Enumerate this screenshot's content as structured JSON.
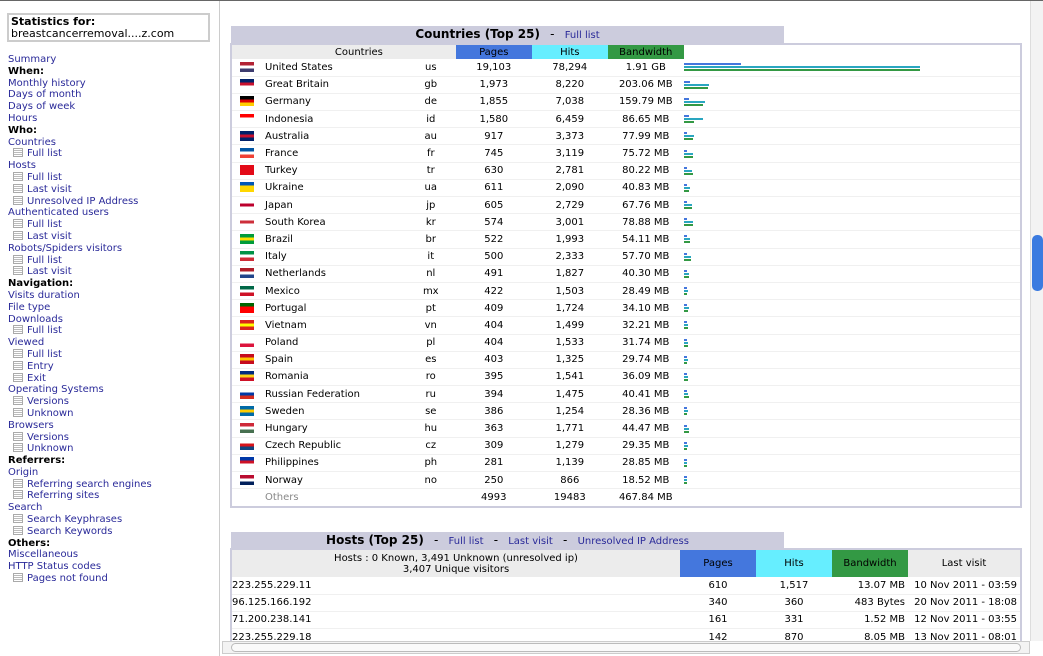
{
  "sidebar": {
    "stats_label": "Statistics for:",
    "site": "breastcancerremoval....z.com",
    "items": [
      {
        "t": "l",
        "label": "Summary"
      },
      {
        "t": "h",
        "label": "When:"
      },
      {
        "t": "l",
        "label": "Monthly history"
      },
      {
        "t": "l",
        "label": "Days of month"
      },
      {
        "t": "l",
        "label": "Days of week"
      },
      {
        "t": "l",
        "label": "Hours"
      },
      {
        "t": "h",
        "label": "Who:"
      },
      {
        "t": "l",
        "label": "Countries"
      },
      {
        "t": "s",
        "label": "Full list"
      },
      {
        "t": "l",
        "label": "Hosts"
      },
      {
        "t": "s",
        "label": "Full list"
      },
      {
        "t": "s",
        "label": "Last visit"
      },
      {
        "t": "s",
        "label": "Unresolved IP Address"
      },
      {
        "t": "l",
        "label": "Authenticated users"
      },
      {
        "t": "s",
        "label": "Full list"
      },
      {
        "t": "s",
        "label": "Last visit"
      },
      {
        "t": "l",
        "label": "Robots/Spiders visitors"
      },
      {
        "t": "s",
        "label": "Full list"
      },
      {
        "t": "s",
        "label": "Last visit"
      },
      {
        "t": "h",
        "label": "Navigation:"
      },
      {
        "t": "l",
        "label": "Visits duration"
      },
      {
        "t": "l",
        "label": "File type"
      },
      {
        "t": "l",
        "label": "Downloads"
      },
      {
        "t": "s",
        "label": "Full list"
      },
      {
        "t": "l",
        "label": "Viewed"
      },
      {
        "t": "s",
        "label": "Full list"
      },
      {
        "t": "s",
        "label": "Entry"
      },
      {
        "t": "s",
        "label": "Exit"
      },
      {
        "t": "l",
        "label": "Operating Systems"
      },
      {
        "t": "s",
        "label": "Versions"
      },
      {
        "t": "s",
        "label": "Unknown"
      },
      {
        "t": "l",
        "label": "Browsers"
      },
      {
        "t": "s",
        "label": "Versions"
      },
      {
        "t": "s",
        "label": "Unknown"
      },
      {
        "t": "h",
        "label": "Referrers:"
      },
      {
        "t": "l",
        "label": "Origin"
      },
      {
        "t": "s",
        "label": "Referring search engines"
      },
      {
        "t": "s",
        "label": "Referring sites"
      },
      {
        "t": "l",
        "label": "Search"
      },
      {
        "t": "s",
        "label": "Search Keyphrases"
      },
      {
        "t": "s",
        "label": "Search Keywords"
      },
      {
        "t": "h",
        "label": "Others:"
      },
      {
        "t": "l",
        "label": "Miscellaneous"
      },
      {
        "t": "l",
        "label": "HTTP Status codes"
      },
      {
        "t": "s",
        "label": "Pages not found"
      }
    ]
  },
  "colors": {
    "pages": "#4477dd",
    "hits": "#66eeff",
    "bandwidth": "#339944"
  },
  "countries": {
    "title": "Countries (Top 25)",
    "sep": "-",
    "full_list": "Full list",
    "headers": {
      "countries": "Countries",
      "pages": "Pages",
      "hits": "Hits",
      "bandwidth": "Bandwidth"
    },
    "rows": [
      {
        "name": "United States",
        "code": "us",
        "pages": "19,103",
        "hits": "78,294",
        "bw": "1.91 GB",
        "flag": [
          "#b22234",
          "#fff",
          "#3c3b6e"
        ]
      },
      {
        "name": "Great Britain",
        "code": "gb",
        "pages": "1,973",
        "hits": "8,220",
        "bw": "203.06 MB",
        "flag": [
          "#012169",
          "#c8102e",
          "#fff"
        ]
      },
      {
        "name": "Germany",
        "code": "de",
        "pages": "1,855",
        "hits": "7,038",
        "bw": "159.79 MB",
        "flag": [
          "#000",
          "#dd0000",
          "#ffce00"
        ]
      },
      {
        "name": "Indonesia",
        "code": "id",
        "pages": "1,580",
        "hits": "6,459",
        "bw": "86.65 MB",
        "flag": [
          "#ff0000",
          "#fff",
          "#fff"
        ]
      },
      {
        "name": "Australia",
        "code": "au",
        "pages": "917",
        "hits": "3,373",
        "bw": "77.99 MB",
        "flag": [
          "#012169",
          "#c8102e",
          "#012169"
        ]
      },
      {
        "name": "France",
        "code": "fr",
        "pages": "745",
        "hits": "3,119",
        "bw": "75.72 MB",
        "flag": [
          "#0055a4",
          "#fff",
          "#ef4135"
        ]
      },
      {
        "name": "Turkey",
        "code": "tr",
        "pages": "630",
        "hits": "2,781",
        "bw": "80.22 MB",
        "flag": [
          "#e30a17",
          "#e30a17",
          "#e30a17"
        ]
      },
      {
        "name": "Ukraine",
        "code": "ua",
        "pages": "611",
        "hits": "2,090",
        "bw": "40.83 MB",
        "flag": [
          "#0057b7",
          "#ffd700",
          "#ffd700"
        ]
      },
      {
        "name": "Japan",
        "code": "jp",
        "pages": "605",
        "hits": "2,729",
        "bw": "67.76 MB",
        "flag": [
          "#fff",
          "#bc002d",
          "#fff"
        ]
      },
      {
        "name": "South Korea",
        "code": "kr",
        "pages": "574",
        "hits": "3,001",
        "bw": "78.88 MB",
        "flag": [
          "#fff",
          "#cd2e3a",
          "#fff"
        ]
      },
      {
        "name": "Brazil",
        "code": "br",
        "pages": "522",
        "hits": "1,993",
        "bw": "54.11 MB",
        "flag": [
          "#009c3b",
          "#ffdf00",
          "#009c3b"
        ]
      },
      {
        "name": "Italy",
        "code": "it",
        "pages": "500",
        "hits": "2,333",
        "bw": "57.70 MB",
        "flag": [
          "#009246",
          "#fff",
          "#ce2b37"
        ]
      },
      {
        "name": "Netherlands",
        "code": "nl",
        "pages": "491",
        "hits": "1,827",
        "bw": "40.30 MB",
        "flag": [
          "#ae1c28",
          "#fff",
          "#21468b"
        ]
      },
      {
        "name": "Mexico",
        "code": "mx",
        "pages": "422",
        "hits": "1,503",
        "bw": "28.49 MB",
        "flag": [
          "#006847",
          "#fff",
          "#ce1126"
        ]
      },
      {
        "name": "Portugal",
        "code": "pt",
        "pages": "409",
        "hits": "1,724",
        "bw": "34.10 MB",
        "flag": [
          "#006600",
          "#ff0000",
          "#ff0000"
        ]
      },
      {
        "name": "Vietnam",
        "code": "vn",
        "pages": "404",
        "hits": "1,499",
        "bw": "32.21 MB",
        "flag": [
          "#da251d",
          "#ffff00",
          "#da251d"
        ]
      },
      {
        "name": "Poland",
        "code": "pl",
        "pages": "404",
        "hits": "1,533",
        "bw": "31.74 MB",
        "flag": [
          "#fff",
          "#fff",
          "#dc143c"
        ]
      },
      {
        "name": "Spain",
        "code": "es",
        "pages": "403",
        "hits": "1,325",
        "bw": "29.74 MB",
        "flag": [
          "#c60b1e",
          "#ffc400",
          "#c60b1e"
        ]
      },
      {
        "name": "Romania",
        "code": "ro",
        "pages": "395",
        "hits": "1,541",
        "bw": "36.09 MB",
        "flag": [
          "#002b7f",
          "#fcd116",
          "#ce1126"
        ]
      },
      {
        "name": "Russian Federation",
        "code": "ru",
        "pages": "394",
        "hits": "1,475",
        "bw": "40.41 MB",
        "flag": [
          "#fff",
          "#0039a6",
          "#d52b1e"
        ]
      },
      {
        "name": "Sweden",
        "code": "se",
        "pages": "386",
        "hits": "1,254",
        "bw": "28.36 MB",
        "flag": [
          "#006aa7",
          "#fecc00",
          "#006aa7"
        ]
      },
      {
        "name": "Hungary",
        "code": "hu",
        "pages": "363",
        "hits": "1,771",
        "bw": "44.47 MB",
        "flag": [
          "#ce2939",
          "#fff",
          "#477050"
        ]
      },
      {
        "name": "Czech Republic",
        "code": "cz",
        "pages": "309",
        "hits": "1,279",
        "bw": "29.35 MB",
        "flag": [
          "#fff",
          "#d7141a",
          "#11457e"
        ]
      },
      {
        "name": "Philippines",
        "code": "ph",
        "pages": "281",
        "hits": "1,139",
        "bw": "28.85 MB",
        "flag": [
          "#0038a8",
          "#ce1126",
          "#fff"
        ]
      },
      {
        "name": "Norway",
        "code": "no",
        "pages": "250",
        "hits": "866",
        "bw": "18.52 MB",
        "flag": [
          "#ba0c2f",
          "#fff",
          "#00205b"
        ]
      }
    ],
    "others": {
      "name": "Others",
      "pages": "4993",
      "hits": "19483",
      "bw": "467.84 MB"
    }
  },
  "hosts": {
    "title": "Hosts (Top 25)",
    "sep": "-",
    "full_list": "Full list",
    "last_visit_link": "Last visit",
    "unresolved": "Unresolved IP Address",
    "summary1": "Hosts : 0 Known, 3,491 Unknown (unresolved ip)",
    "summary2": "3,407 Unique visitors",
    "headers": {
      "pages": "Pages",
      "hits": "Hits",
      "bandwidth": "Bandwidth",
      "last_visit": "Last visit"
    },
    "rows": [
      {
        "host": "223.255.229.11",
        "pages": "610",
        "hits": "1,517",
        "bw": "13.07 MB",
        "last": "10 Nov 2011 - 03:59"
      },
      {
        "host": "96.125.166.192",
        "pages": "340",
        "hits": "360",
        "bw": "483 Bytes",
        "last": "20 Nov 2011 - 18:08"
      },
      {
        "host": "71.200.238.141",
        "pages": "161",
        "hits": "331",
        "bw": "1.52 MB",
        "last": "12 Nov 2011 - 03:55"
      },
      {
        "host": "223.255.229.18",
        "pages": "142",
        "hits": "870",
        "bw": "8.05 MB",
        "last": "13 Nov 2011 - 08:01"
      }
    ]
  }
}
